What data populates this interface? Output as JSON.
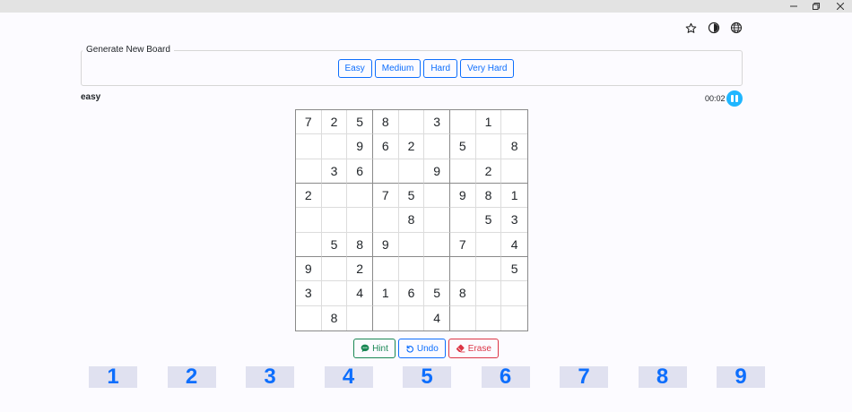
{
  "window": {
    "controls": [
      "minimize-icon",
      "restore-icon",
      "close-icon"
    ]
  },
  "header_icons": [
    "star-icon",
    "theme-icon",
    "globe-icon"
  ],
  "generate": {
    "legend": "Generate New Board",
    "difficulties": [
      "Easy",
      "Medium",
      "Hard",
      "Very Hard"
    ]
  },
  "status": {
    "level": "easy",
    "timer": "00:02"
  },
  "board": [
    [
      "7",
      "2",
      "5",
      "8",
      "",
      "3",
      "",
      "1",
      ""
    ],
    [
      "",
      "",
      "9",
      "6",
      "2",
      "",
      "5",
      "",
      "8"
    ],
    [
      "",
      "3",
      "6",
      "",
      "",
      "9",
      "",
      "2",
      ""
    ],
    [
      "2",
      "",
      "",
      "7",
      "5",
      "",
      "9",
      "8",
      "1"
    ],
    [
      "",
      "",
      "",
      "",
      "8",
      "",
      "",
      "5",
      "3"
    ],
    [
      "",
      "5",
      "8",
      "9",
      "",
      "",
      "7",
      "",
      "4"
    ],
    [
      "9",
      "",
      "2",
      "",
      "",
      "",
      "",
      "",
      "5"
    ],
    [
      "3",
      "",
      "4",
      "1",
      "6",
      "5",
      "8",
      "",
      ""
    ],
    [
      "",
      "8",
      "",
      "",
      "",
      "4",
      "",
      "",
      ""
    ]
  ],
  "actions": {
    "hint": "Hint",
    "undo": "Undo",
    "erase": "Erase"
  },
  "numpad": [
    "1",
    "2",
    "3",
    "4",
    "5",
    "6",
    "7",
    "8",
    "9"
  ],
  "colors": {
    "primary": "#0d6efd",
    "success": "#198754",
    "danger": "#dc3545",
    "pause": "#1fb6ff",
    "numpad_bg": "#e0e1f0"
  }
}
